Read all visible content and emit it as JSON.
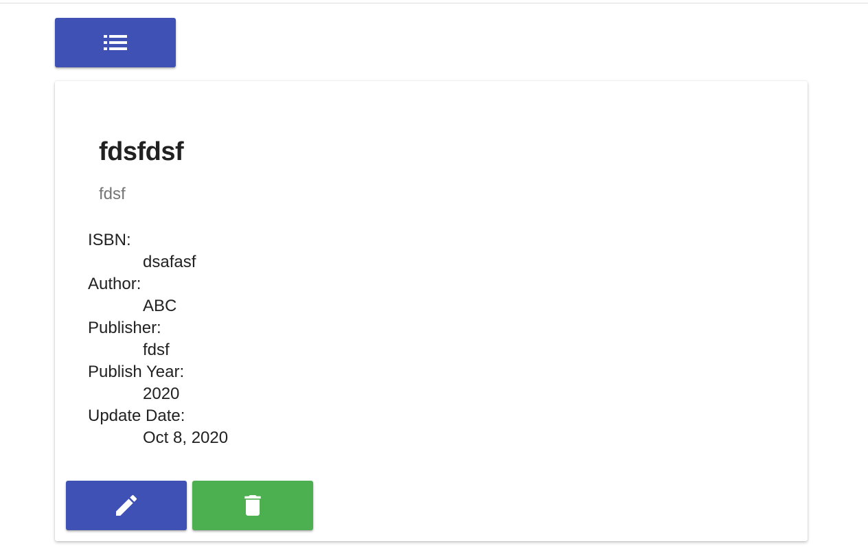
{
  "colors": {
    "primary": "#3f51b5",
    "success": "#4caf50",
    "icon": "#ffffff"
  },
  "toolbar": {
    "list_icon": "list-icon"
  },
  "book": {
    "title": "fdsfdsf",
    "subtitle": "fdsf",
    "fields": [
      {
        "label": "ISBN:",
        "value": "dsafasf"
      },
      {
        "label": "Author:",
        "value": "ABC"
      },
      {
        "label": "Publisher:",
        "value": "fdsf"
      },
      {
        "label": "Publish Year:",
        "value": "2020"
      },
      {
        "label": "Update Date:",
        "value": "Oct 8, 2020"
      }
    ]
  },
  "actions": {
    "edit_icon": "pencil-icon",
    "delete_icon": "trash-icon"
  }
}
